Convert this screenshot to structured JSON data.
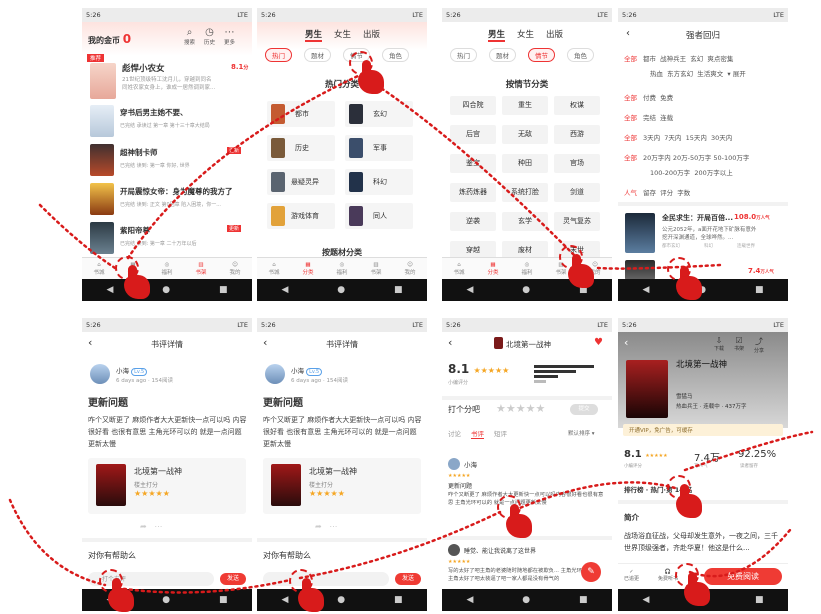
{
  "status": {
    "time": "5:26",
    "net": "LTE"
  },
  "s1": {
    "coins_label": "我的金币",
    "coins": "0",
    "icons": [
      "搜索",
      "历史",
      "更多"
    ],
    "rec_tag": "推荐",
    "featured_title": "彪悍小农女",
    "featured_score": "8.1",
    "featured_unit": "分",
    "featured_desc1": "21世纪顶级特工沈月儿，穿越到同名",
    "featured_desc2": "同姓农家女身上，谁成一居然调到家...",
    "books": [
      {
        "title": "穿书后男主她不要、",
        "meta": "已完结 承读过 第一章 第十三十章大结局"
      },
      {
        "title": "超神制卡师",
        "meta": "已完结 读到: 第一章 你好, 世界",
        "badge": "更新"
      },
      {
        "title": "开局震惊女帝：身为魔尊的我方了",
        "meta": "已完结 读到: 正文 第0回章 陷入困境，你一..."
      },
      {
        "title": "紫阳帝尊",
        "meta": "已完结 读到: 第一章 二十万年以后",
        "badge": "更新"
      }
    ],
    "tabs": [
      "书城",
      "分类",
      "福利",
      "书架",
      "我的"
    ]
  },
  "s2": {
    "top_tabs": [
      "男生",
      "女生",
      "出版"
    ],
    "filters": [
      "热门",
      "题材",
      "情节",
      "角色"
    ],
    "section": "热门分类",
    "cats": [
      "都市",
      "玄幻",
      "历史",
      "军事",
      "悬疑灵异",
      "科幻",
      "游戏体育",
      "同人"
    ],
    "section2": "按题材分类",
    "tabs": [
      "书城",
      "分类",
      "福利",
      "书架",
      "我的"
    ]
  },
  "s3": {
    "top_tabs": [
      "男生",
      "女生",
      "出版"
    ],
    "filters": [
      "热门",
      "题材",
      "情节",
      "角色"
    ],
    "section": "按情节分类",
    "cells": [
      "四合院",
      "重生",
      "权谋",
      "后宫",
      "无敌",
      "西游",
      "鉴宝",
      "种田",
      "官场",
      "炼药炼器",
      "系统打脸",
      "剑道",
      "逆袭",
      "玄学",
      "灵气复苏",
      "穿越",
      "废材",
      "末世"
    ],
    "tabs": [
      "书城",
      "分类",
      "福利",
      "书架",
      "我的"
    ]
  },
  "s4": {
    "title": "强者回归",
    "rows": [
      [
        "全部",
        "都市",
        "战神兵王",
        "玄幻",
        "爽点密集"
      ],
      [
        "热血",
        "东方玄幻",
        "生活爽文",
        "▾ 展开"
      ],
      [
        "全部",
        "付费",
        "免费"
      ],
      [
        "全部",
        "完结",
        "连载"
      ],
      [
        "全部",
        "3天内",
        "7天内",
        "15天内",
        "30天内"
      ],
      [
        "全部",
        "20万字内",
        "20万-50万字",
        "50-100万字"
      ],
      [
        "100-200万字",
        "200万字以上"
      ],
      [
        "人气",
        "留存",
        "评分",
        "字数"
      ]
    ],
    "book_title": "全民求生：开局百倍...",
    "book_score": "108.0",
    "book_score_unit": "万人气",
    "book_desc1": "公元2052年，a面开花地下矿脉有意外",
    "book_desc2": "挖开深渊通道，全球哗然。...",
    "book_tags": [
      "都市玄幻",
      "科幻",
      "连载世界"
    ],
    "book2_score": "7.4",
    "book2_unit": "万人气"
  },
  "s5": {
    "header": "书评详情",
    "user": "小海",
    "level": "Lv.5",
    "time": "6 days ago · 154阅读",
    "post_title": "更新问题",
    "body": "咋个又断更了 麻烦作者大大更新快一点可以吗 内容很好看 也很有意思 主角光环可以的 就是一点问题更新太慢",
    "book": "北境第一战神",
    "book_sub": "楼主打分",
    "helpful": "对你有帮助么",
    "input_ph": "打个友评",
    "send": "发送"
  },
  "s6": {
    "header": "书评详情",
    "user": "小海",
    "level": "Lv.5",
    "time": "6 days ago · 154阅读",
    "post_title": "更新问题",
    "body": "咋个又断更了 麻烦作者大大更新快一点可以吗 内容很好看 也很有意思 主角光环可以的 就是一点问题更新太慢",
    "book": "北境第一战神",
    "book_sub": "楼主打分",
    "helpful": "对你有帮助么",
    "send": "发送"
  },
  "s7": {
    "title": "北境第一战神",
    "score": "8.1",
    "score_label": "小编评分",
    "rate_label": "打个分吧",
    "rate_btn": "提交",
    "tabs": [
      "讨论",
      "书评",
      "短评"
    ],
    "sort": "默认排序 ▾",
    "c1_user": "小海",
    "c1_title": "更新问题",
    "c1_body": "咋个又断更了 麻烦作者大大更新快一点可以吗内容很好看也很有意思 主角光环可以的 就是一点问题更新太慢",
    "c2_user": "睡觉、能让我说离了这世界",
    "c2_body": "写的太好了吧主角的老婆随时随地都在被欺负... 主角光环 主角太好了吧太装逼了吧一家人都是没有骨气的"
  },
  "s8": {
    "icons": [
      "下载",
      "书架",
      "分享"
    ],
    "title": "北境第一战神",
    "author": "雪猛马",
    "meta": "热血兵王 · 连载中 · 437万字",
    "vip": "开通VIP，免广告，可缓存",
    "stat1": "8.1",
    "stat1_label": "小编评分",
    "stat2": "7.4万",
    "stat2_label": "万人气",
    "stat3": "92.25%",
    "stat3_label": "读者留存",
    "rank": "排行榜 · 热门·第 14 名",
    "intro_h": "简介",
    "intro": "战场浴血征战，父母却发生意外，一夜之间，三千世界顶级强者，齐赴华夏！他这是什么...",
    "bottom": [
      "已追更",
      "免费听书"
    ],
    "read": "免费阅读"
  }
}
